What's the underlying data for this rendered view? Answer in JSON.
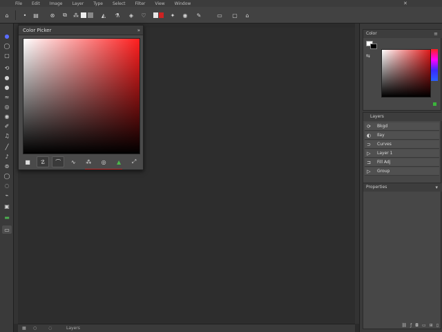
{
  "menubar": {
    "items": [
      "File",
      "Edit",
      "Image",
      "Layer",
      "Type",
      "Select",
      "Filter",
      "View",
      "Window"
    ]
  },
  "options_bar": {
    "buttons": [
      "home-icon",
      "tool-preset-icon",
      "brush-icon",
      "mode-icon",
      "pressure-icon",
      "airbrush-icon",
      "fill-swatch-icon",
      "gradient-icon",
      "blend-icon",
      "opacity-icon",
      "flow-icon",
      "smoothing-icon",
      "settings-icon",
      "target-icon",
      "symmetry-icon"
    ]
  },
  "tools": {
    "items": [
      "move-icon",
      "marquee-icon",
      "lasso-icon",
      "quick-select-icon",
      "crop-icon",
      "eyedropper-icon",
      "healing-icon",
      "brush-icon",
      "clone-icon",
      "history-brush-icon",
      "eraser-icon",
      "gradient-icon",
      "blur-icon",
      "dodge-icon",
      "pen-icon",
      "type-icon",
      "path-select-icon",
      "shape-icon",
      "hand-icon",
      "zoom-icon",
      "swatches-icon",
      "mask-icon",
      "screen-mode-icon"
    ]
  },
  "picker": {
    "title": "Color Picker",
    "colors": {
      "hue": "#ff1e1e",
      "accent_line": "#b22222"
    }
  },
  "color_panel": {
    "tab_label": "Color",
    "fg": "#ffffff",
    "bg": "#000000",
    "hue": "#e01b1b"
  },
  "layers_panel": {
    "tab_label": "Layers",
    "rows": [
      {
        "icon": "fx-icon",
        "label": "Bkgd"
      },
      {
        "icon": "eye-icon",
        "label": "Ilay"
      },
      {
        "icon": "link-icon",
        "label": "Curves"
      },
      {
        "icon": "play-icon",
        "label": "Layer 1"
      },
      {
        "icon": "adjust-icon",
        "label": "Fill Adj"
      },
      {
        "icon": "group-icon",
        "label": "Group"
      }
    ]
  },
  "props_panel": {
    "tab_label": "Properties"
  },
  "status": {
    "text": "Layers"
  }
}
